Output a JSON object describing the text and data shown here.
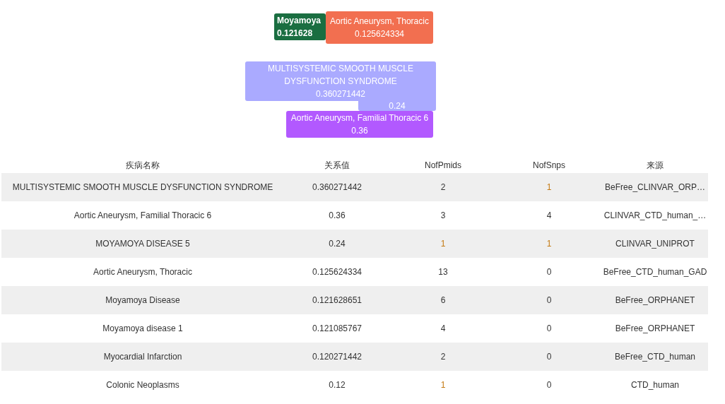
{
  "bubbles": [
    {
      "name": "Moyamoya",
      "value": "0.121628",
      "color": "#1a6e41"
    },
    {
      "name": "Aortic Aneurysm, Thoracic",
      "value": "0.125624334",
      "color": "#f26f50"
    },
    {
      "name": "MULTISYSTEMIC SMOOTH MUSCLE DYSFUNCTION SYNDROME",
      "value": "0.360271442",
      "color": "#aaaaff"
    },
    {
      "value": "0.24",
      "color": "#aaaaff"
    },
    {
      "name": "Aortic Aneurysm, Familial Thoracic 6",
      "value": "0.36",
      "color": "#b259ff"
    }
  ],
  "table": {
    "columns": [
      "疾病名称",
      "关系值",
      "NofPmids",
      "NofSnps",
      "来源"
    ],
    "rows": [
      {
        "cells": [
          {
            "text": "MULTISYSTEMIC SMOOTH MUSCLE DYSFUNCTION SYNDROME",
            "accent": false
          },
          {
            "text": "0.360271442",
            "accent": false
          },
          {
            "text": "2",
            "accent": false
          },
          {
            "text": "1",
            "accent": true
          },
          {
            "text": "BeFree_CLINVAR_ORP…",
            "accent": false
          }
        ]
      },
      {
        "cells": [
          {
            "text": "Aortic Aneurysm, Familial Thoracic 6",
            "accent": false
          },
          {
            "text": "0.36",
            "accent": false
          },
          {
            "text": "3",
            "accent": false
          },
          {
            "text": "4",
            "accent": false
          },
          {
            "text": "CLINVAR_CTD_human_…",
            "accent": false
          }
        ]
      },
      {
        "cells": [
          {
            "text": "MOYAMOYA DISEASE 5",
            "accent": false
          },
          {
            "text": "0.24",
            "accent": false
          },
          {
            "text": "1",
            "accent": true
          },
          {
            "text": "1",
            "accent": true
          },
          {
            "text": "CLINVAR_UNIPROT",
            "accent": false
          }
        ]
      },
      {
        "cells": [
          {
            "text": "Aortic Aneurysm, Thoracic",
            "accent": false
          },
          {
            "text": "0.125624334",
            "accent": false
          },
          {
            "text": "13",
            "accent": false
          },
          {
            "text": "0",
            "accent": false
          },
          {
            "text": "BeFree_CTD_human_GAD",
            "accent": false
          }
        ]
      },
      {
        "cells": [
          {
            "text": "Moyamoya Disease",
            "accent": false
          },
          {
            "text": "0.121628651",
            "accent": false
          },
          {
            "text": "6",
            "accent": false
          },
          {
            "text": "0",
            "accent": false
          },
          {
            "text": "BeFree_ORPHANET",
            "accent": false
          }
        ]
      },
      {
        "cells": [
          {
            "text": "Moyamoya disease 1",
            "accent": false
          },
          {
            "text": "0.121085767",
            "accent": false
          },
          {
            "text": "4",
            "accent": false
          },
          {
            "text": "0",
            "accent": false
          },
          {
            "text": "BeFree_ORPHANET",
            "accent": false
          }
        ]
      },
      {
        "cells": [
          {
            "text": "Myocardial Infarction",
            "accent": false
          },
          {
            "text": "0.120271442",
            "accent": false
          },
          {
            "text": "2",
            "accent": false
          },
          {
            "text": "0",
            "accent": false
          },
          {
            "text": "BeFree_CTD_human",
            "accent": false
          }
        ]
      },
      {
        "cells": [
          {
            "text": "Colonic Neoplasms",
            "accent": false
          },
          {
            "text": "0.12",
            "accent": false
          },
          {
            "text": "1",
            "accent": true
          },
          {
            "text": "0",
            "accent": false
          },
          {
            "text": "CTD_human",
            "accent": false
          }
        ]
      }
    ]
  }
}
